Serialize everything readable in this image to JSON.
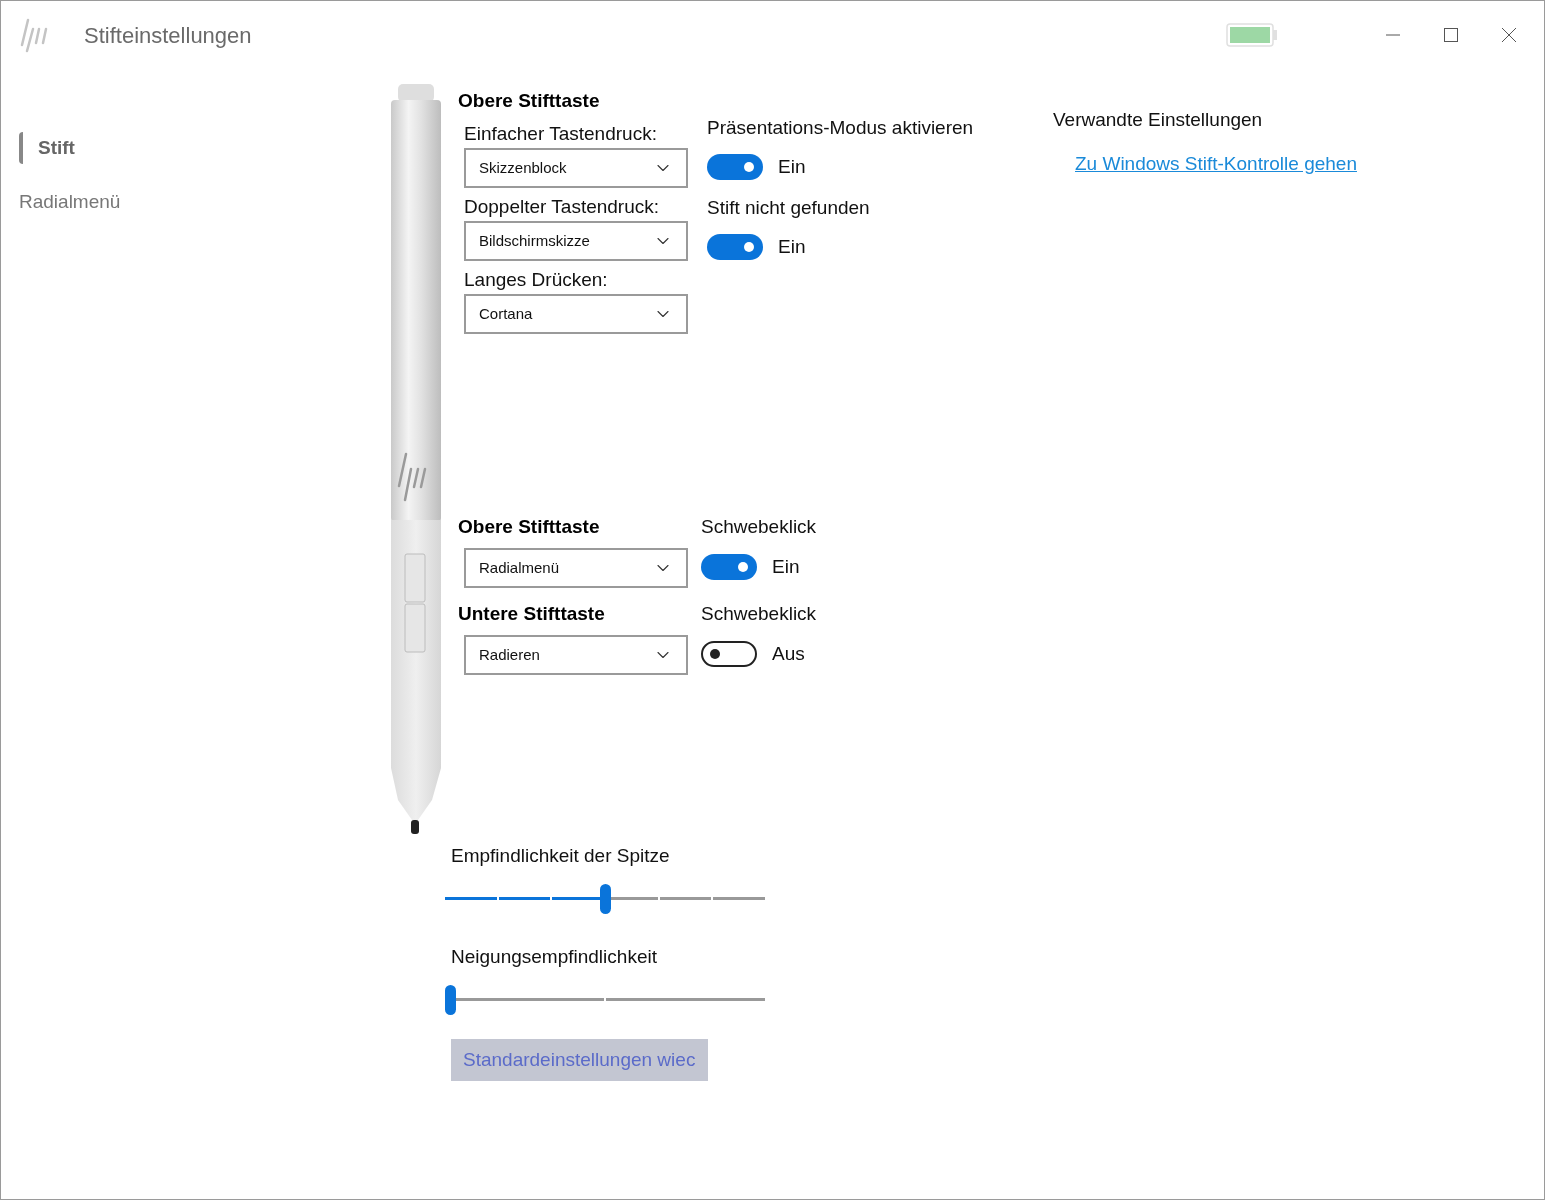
{
  "window": {
    "title": "Stifteinstellungen"
  },
  "sidebar": {
    "items": [
      {
        "label": "Stift",
        "selected": true
      },
      {
        "label": "Radialmenü",
        "selected": false
      }
    ]
  },
  "top_button": {
    "heading": "Obere Stifttaste",
    "dropdowns": [
      {
        "label": "Einfacher Tastendruck:",
        "value": "Skizzenblock"
      },
      {
        "label": "Doppelter Tastendruck:",
        "value": "Bildschirmskizze"
      },
      {
        "label": "Langes Drücken:",
        "value": "Cortana"
      }
    ]
  },
  "top_toggles": [
    {
      "label": "Präsentations-Modus aktivieren",
      "on": true,
      "state_text": "Ein"
    },
    {
      "label": "Stift nicht gefunden",
      "on": true,
      "state_text": "Ein"
    }
  ],
  "related": {
    "heading": "Verwandte Einstellungen",
    "link": "Zu Windows Stift-Kontrolle gehen"
  },
  "barrel_buttons": [
    {
      "heading": "Obere Stifttaste",
      "value": "Radialmenü",
      "toggle_label": "Schwebeklick",
      "on": true,
      "state_text": "Ein"
    },
    {
      "heading": "Untere Stifttaste",
      "value": "Radieren",
      "toggle_label": "Schwebeklick",
      "on": false,
      "state_text": "Aus"
    }
  ],
  "sliders": [
    {
      "label": "Empfindlichkeit der Spitze",
      "kind": "fine",
      "level": 0.5
    },
    {
      "label": "Neigungsempfindlichkeit",
      "kind": "coarse",
      "level": 0
    }
  ],
  "reset_button": {
    "label": "Standardeinstellungen wiec",
    "disabled": true
  }
}
